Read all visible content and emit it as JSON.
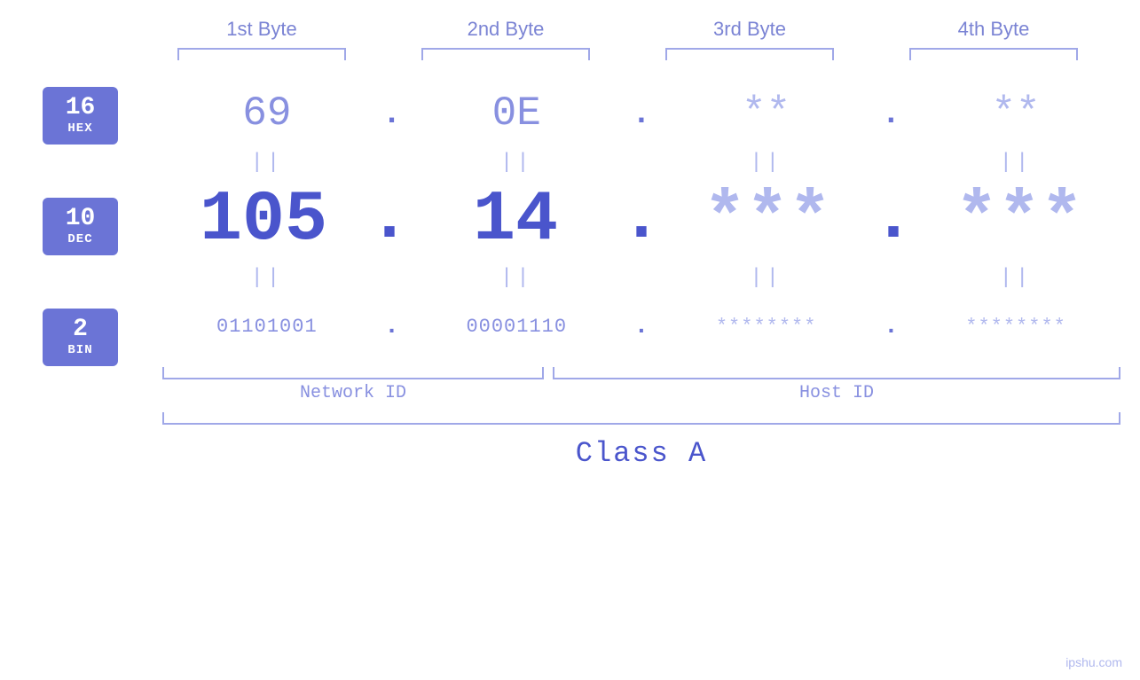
{
  "headers": {
    "byte1": "1st Byte",
    "byte2": "2nd Byte",
    "byte3": "3rd Byte",
    "byte4": "4th Byte"
  },
  "badges": {
    "hex": {
      "number": "16",
      "label": "HEX"
    },
    "dec": {
      "number": "10",
      "label": "DEC"
    },
    "bin": {
      "number": "2",
      "label": "BIN"
    }
  },
  "values": {
    "hex": {
      "b1": "69",
      "b2": "0E",
      "b3": "**",
      "b4": "**"
    },
    "dec": {
      "b1": "105",
      "b2": "14",
      "b3": "***",
      "b4": "***"
    },
    "bin": {
      "b1": "01101001",
      "b2": "00001110",
      "b3": "********",
      "b4": "********"
    }
  },
  "separators": {
    "hex_sep": "||",
    "dec_sep": "||",
    "bin_sep": "||",
    "dot": "."
  },
  "labels": {
    "network_id": "Network ID",
    "host_id": "Host ID",
    "class": "Class A"
  },
  "watermark": "ipshu.com"
}
